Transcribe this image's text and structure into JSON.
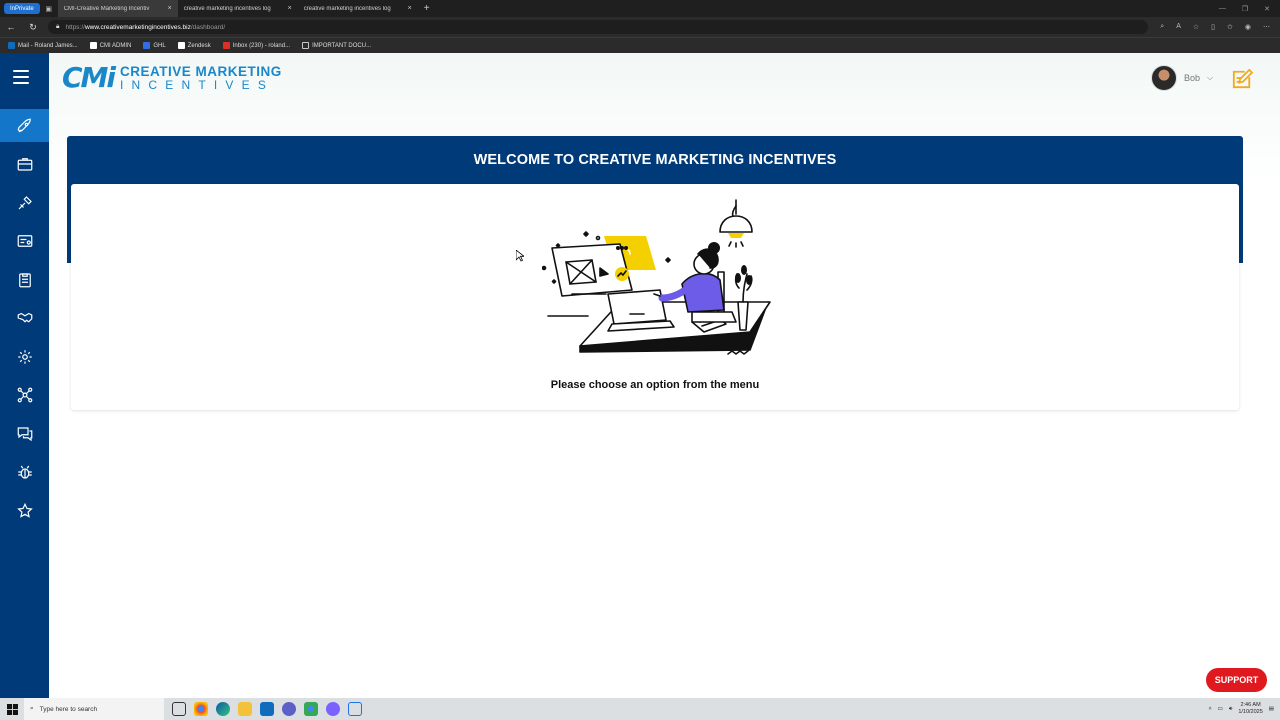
{
  "browser": {
    "inprivate_label": "InPrivate",
    "tabs": [
      {
        "title": "CMI-Creative Marketing Incentiv",
        "active": true
      },
      {
        "title": "creative marketing incentives log",
        "active": false
      },
      {
        "title": "creative marketing incentives log",
        "active": false
      }
    ],
    "tab_close": "×",
    "new_tab": "+",
    "url_scheme": "https://",
    "url_host": "www.creativemarketingincentives.biz",
    "url_path": "/dashboard/",
    "bookmarks": [
      {
        "label": "Mail - Roland James...",
        "color": "#0f6cbd"
      },
      {
        "label": "CMI ADMIN",
        "color": "#ffffff"
      },
      {
        "label": "GHL",
        "color": "#2f6fe0"
      },
      {
        "label": "Zendesk",
        "color": "#ffffff"
      },
      {
        "label": "Inbox (230) - roland...",
        "color": "#d93025"
      },
      {
        "label": "IMPORTANT DOCU...",
        "color": "#c8c8c8"
      }
    ]
  },
  "app": {
    "logo_mark": "CMi",
    "logo_line1": "CREATIVE MARKETING",
    "logo_line2": "INCENTIVES",
    "user_name": "Bob",
    "welcome_title": "WELCOME TO CREATIVE MARKETING INCENTIVES",
    "choose_text": "Please choose an option from the menu",
    "support_label": "SUPPORT",
    "nav_icons": [
      "rocket-icon",
      "briefcase-icon",
      "tools-icon",
      "id-card-icon",
      "clipboard-icon",
      "handshake-icon",
      "gear-icon",
      "network-icon",
      "chat-icon",
      "bug-icon",
      "star-icon"
    ]
  },
  "taskbar": {
    "search_placeholder": "Type here to search",
    "time": "2:46 AM",
    "date": "1/10/2025"
  }
}
